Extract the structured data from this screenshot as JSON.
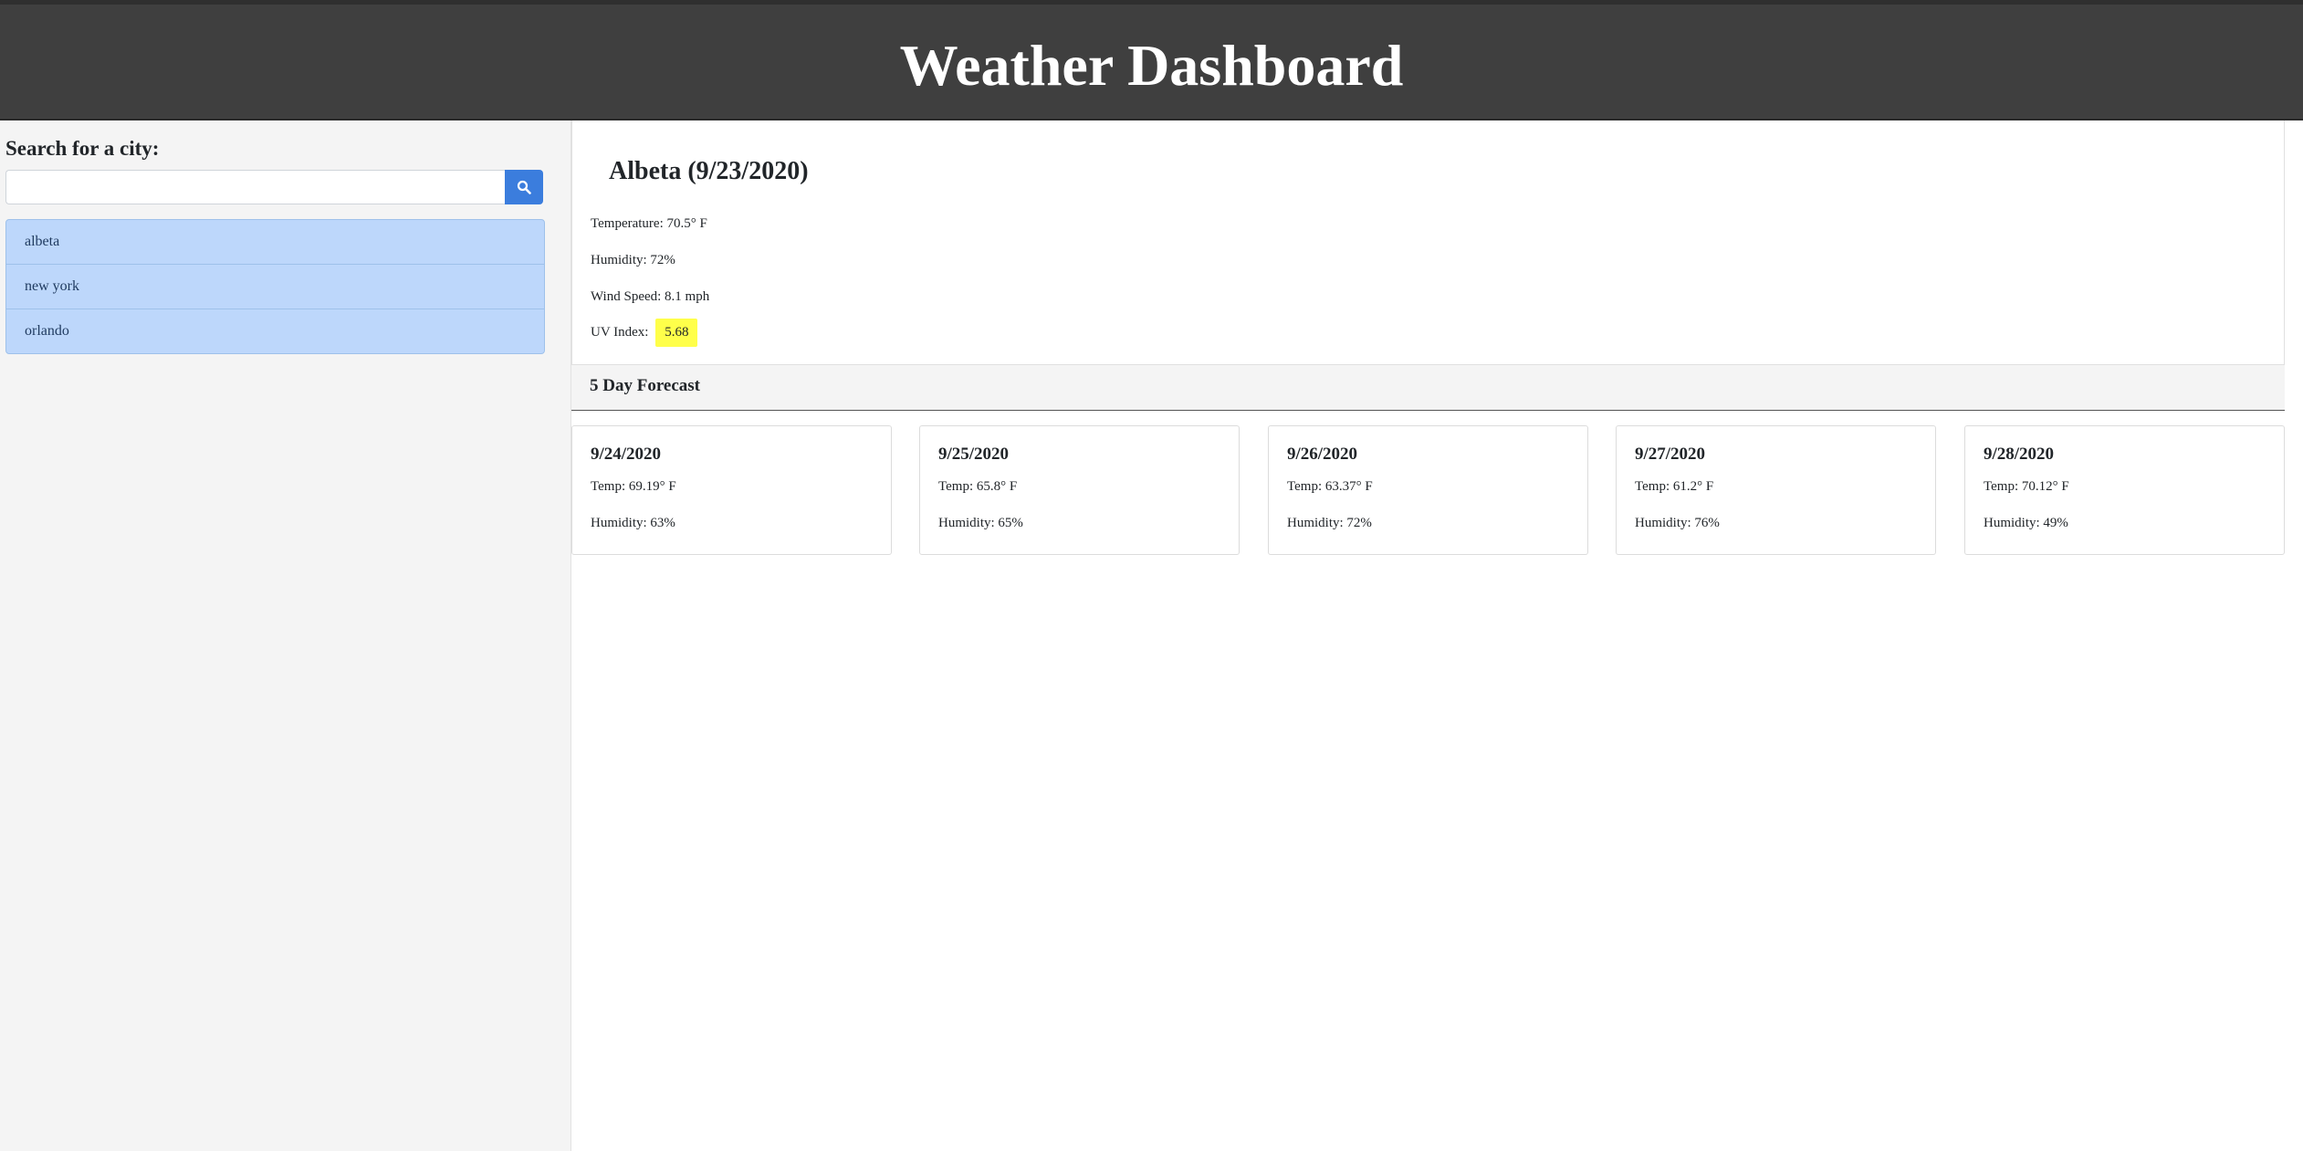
{
  "header": {
    "title": "Weather Dashboard"
  },
  "sidebar": {
    "search_label": "Search for a city:",
    "search_value": "",
    "search_placeholder": "",
    "cities": [
      "albeta",
      "new york",
      "orlando"
    ]
  },
  "current": {
    "title": "Albeta (9/23/2020)",
    "temperature": "Temperature: 70.5° F",
    "humidity": "Humidity: 72%",
    "wind_speed": "Wind Speed: 8.1 mph",
    "uv_label": "UV Index:",
    "uv_value": "5.68",
    "uv_color": "#ffff4a"
  },
  "forecast": {
    "title": "5 Day Forecast",
    "days": [
      {
        "date": "9/24/2020",
        "temp": "Temp: 69.19° F",
        "humidity": "Humidity: 63%"
      },
      {
        "date": "9/25/2020",
        "temp": "Temp: 65.8° F",
        "humidity": "Humidity: 65%"
      },
      {
        "date": "9/26/2020",
        "temp": "Temp: 63.37° F",
        "humidity": "Humidity: 72%"
      },
      {
        "date": "9/27/2020",
        "temp": "Temp: 61.2° F",
        "humidity": "Humidity: 76%"
      },
      {
        "date": "9/28/2020",
        "temp": "Temp: 70.12° F",
        "humidity": "Humidity: 49%"
      }
    ]
  },
  "colors": {
    "header_bg": "#3f3f3f",
    "accent": "#3b7ddd",
    "city_item_bg": "#bdd7fb",
    "sidebar_bg": "#f4f4f4"
  },
  "icons": {
    "search_button": "search-icon"
  }
}
